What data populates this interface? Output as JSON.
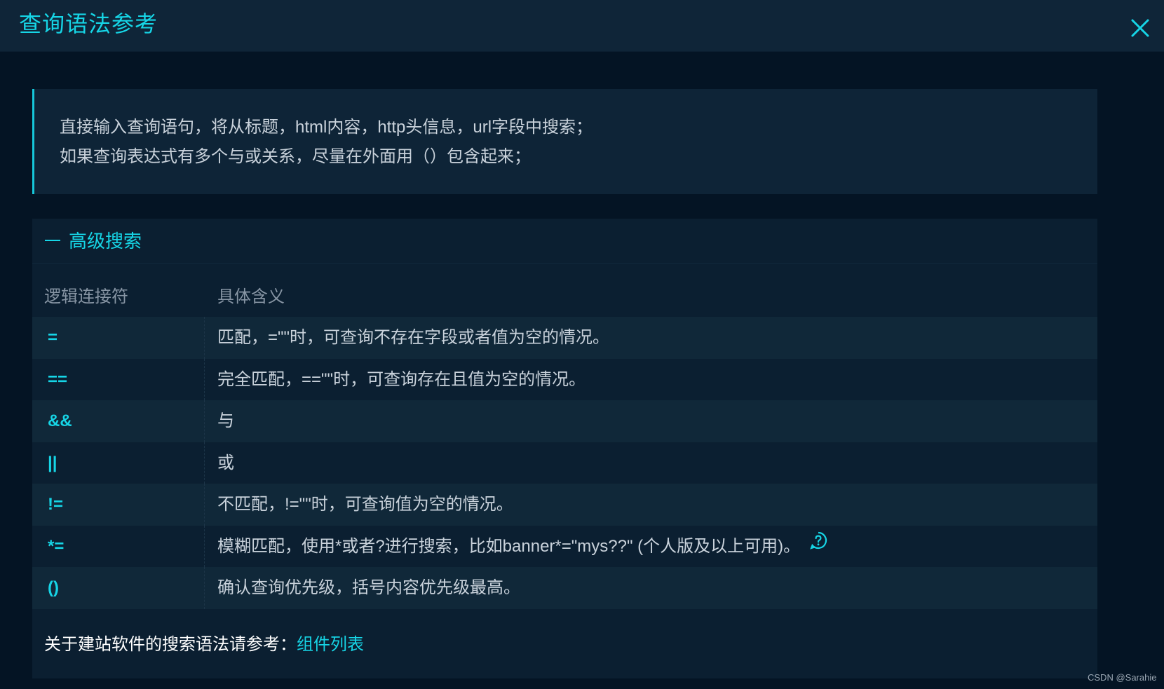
{
  "header": {
    "title": "查询语法参考",
    "close_icon": "close-icon"
  },
  "callout": {
    "lines": [
      "直接输入查询语句，将从标题，html内容，http头信息，url字段中搜索；",
      "如果查询表达式有多个与或关系，尽量在外面用（）包含起来；"
    ]
  },
  "advanced_search": {
    "title": "高级搜索",
    "collapse_icon": "minus-icon",
    "table": {
      "headers": [
        "逻辑连接符",
        "具体含义"
      ],
      "rows": [
        {
          "op": "=",
          "desc": "匹配，=\"\"时，可查询不存在字段或者值为空的情况。"
        },
        {
          "op": "==",
          "desc": "完全匹配，==\"\"时，可查询存在且值为空的情况。"
        },
        {
          "op": "&&",
          "desc": "与"
        },
        {
          "op": "||",
          "desc": "或"
        },
        {
          "op": "!=",
          "desc": "不匹配，!=\"\"时，可查询值为空的情况。"
        },
        {
          "op": "*=",
          "desc": "模糊匹配，使用*或者?进行搜索，比如banner*=\"mys??\" (个人版及以上可用)。",
          "icon": "help-circle-icon"
        },
        {
          "op": "()",
          "desc": "确认查询优先级，括号内容优先级最高。"
        }
      ]
    },
    "footer": {
      "text": "关于建站软件的搜索语法请参考：",
      "link_label": "组件列表"
    }
  },
  "watermark": "CSDN @Sarahie",
  "colors": {
    "accent": "#16d5e6",
    "background": "#041424",
    "panel": "#0b1f31",
    "row_alt": "#102839",
    "text": "#c9d2db"
  }
}
